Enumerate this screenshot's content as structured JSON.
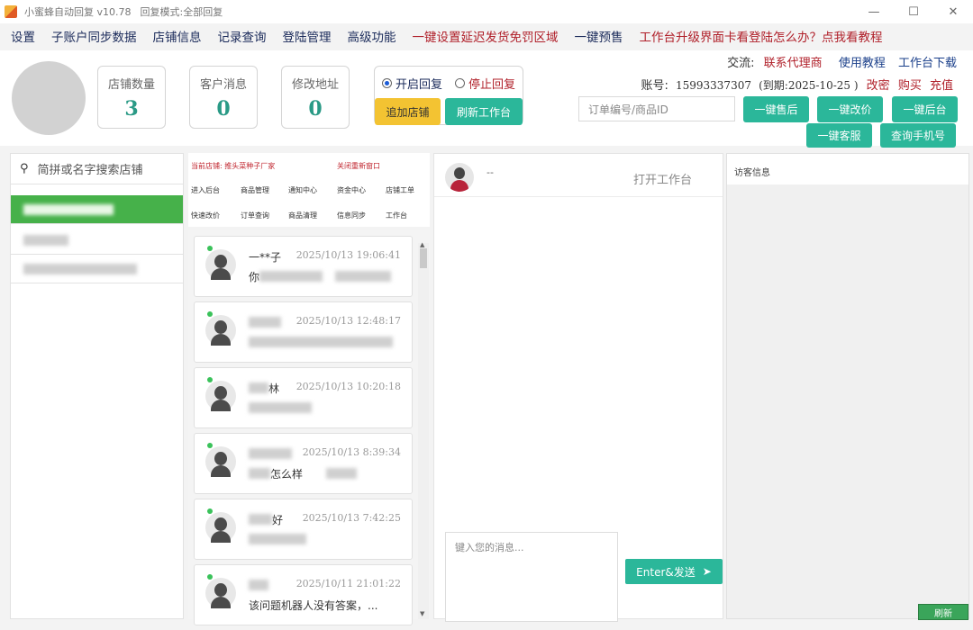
{
  "window": {
    "title": "小蜜蜂自动回复 v10.78",
    "mode": "回复模式:全部回复",
    "controls": [
      "—",
      "☐",
      "✕"
    ]
  },
  "menu": [
    {
      "label": "设置",
      "color": "blue"
    },
    {
      "label": "子账户同步数据",
      "color": "blue"
    },
    {
      "label": "店铺信息",
      "color": "blue"
    },
    {
      "label": "记录查询",
      "color": "blue"
    },
    {
      "label": "登陆管理",
      "color": "blue"
    },
    {
      "label": "高级功能",
      "color": "blue"
    },
    {
      "label": "一键设置延迟发货免罚区域",
      "color": "red"
    },
    {
      "label": "一键预售",
      "color": "blue"
    },
    {
      "label": "工作台升级界面卡看登陆怎么办？点我看教程",
      "color": "red"
    }
  ],
  "stats": [
    {
      "label": "店铺数量",
      "value": "3"
    },
    {
      "label": "客户消息",
      "value": "0"
    },
    {
      "label": "修改地址",
      "value": "0"
    }
  ],
  "reply_control": {
    "on_label": "开启回复",
    "off_label": "停止回复",
    "add_store": "追加店铺",
    "refresh_workbench": "刷新工作台"
  },
  "links": {
    "exchange_label": "交流:",
    "contact_agent": "联系代理商",
    "tutorial": "使用教程",
    "workbench_download": "工作台下载"
  },
  "account": {
    "label": "账号:",
    "number": "15993337307",
    "expiry": "(到期:2025-10-25 )",
    "change_pwd": "改密",
    "buy": "购买",
    "recharge": "充值"
  },
  "order_search": {
    "placeholder": "订单编号/商品ID"
  },
  "quick_buttons": {
    "after_sale": "一键售后",
    "change_price": "一键改价",
    "backend": "一键后台",
    "customer_service": "一键客服",
    "query_phone": "查询手机号"
  },
  "store_search": {
    "placeholder": "简拼或名字搜索店铺"
  },
  "function_panel": {
    "current_store": "当前店铺: 推头菜种子厂家",
    "close_refresh": "关闭重新窗口",
    "row1": [
      "进入后台",
      "商品管理",
      "通知中心",
      "资金中心",
      "店铺工单"
    ],
    "row2": [
      "快速改价",
      "订单查询",
      "商品清理",
      "信息同步",
      "工作台"
    ]
  },
  "chats": [
    {
      "name": "一**子",
      "time": "2025/10/13 19:06:41",
      "msg": "你"
    },
    {
      "name": "",
      "time": "2025/10/13 12:48:17",
      "msg": ""
    },
    {
      "name": "林",
      "time": "2025/10/13 10:20:18",
      "msg": ""
    },
    {
      "name": "",
      "time": "2025/10/13 8:39:34",
      "msg": "怎么样"
    },
    {
      "name": "好",
      "time": "2025/10/13 7:42:25",
      "msg": ""
    },
    {
      "name": "",
      "time": "2025/10/11 21:01:22",
      "msg": "该问题机器人没有答案，..."
    }
  ],
  "chat_panel": {
    "customer_name": "--",
    "open_workbench": "打开工作台",
    "input_placeholder": "键入您的消息...",
    "send_label": "Enter&发送"
  },
  "visitor": {
    "title": "访客信息",
    "refresh": "刷新"
  },
  "colors": {
    "accent_green": "#2bb79a",
    "active_store": "#46b14a",
    "warn_red": "#b0202a",
    "menu_blue": "#1a2a5a"
  }
}
